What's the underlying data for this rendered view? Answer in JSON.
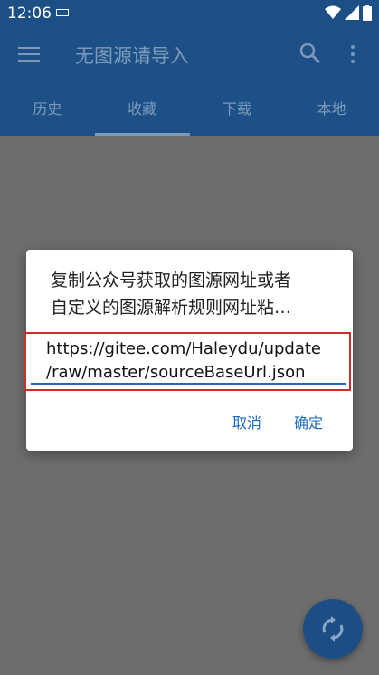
{
  "status_bar": {
    "time": "12:06"
  },
  "app_bar": {
    "title": "无图源请导入"
  },
  "tabs": [
    {
      "label": "历史"
    },
    {
      "label": "收藏"
    },
    {
      "label": "下载"
    },
    {
      "label": "本地"
    }
  ],
  "dialog": {
    "message_line1": "复制公众号获取的图源网址或者",
    "message_line2": "自定义的图源解析规则网址粘…",
    "input_line1": "https://gitee.com/Haleydu/update",
    "input_line2": "/raw/master/sourceBaseUrl.json",
    "cancel_label": "取消",
    "confirm_label": "确定"
  },
  "colors": {
    "app_bar": "#1d5087",
    "accent": "#1d6ac1",
    "scrim": "#6d6d6d",
    "highlight_border": "#d02a2a"
  }
}
